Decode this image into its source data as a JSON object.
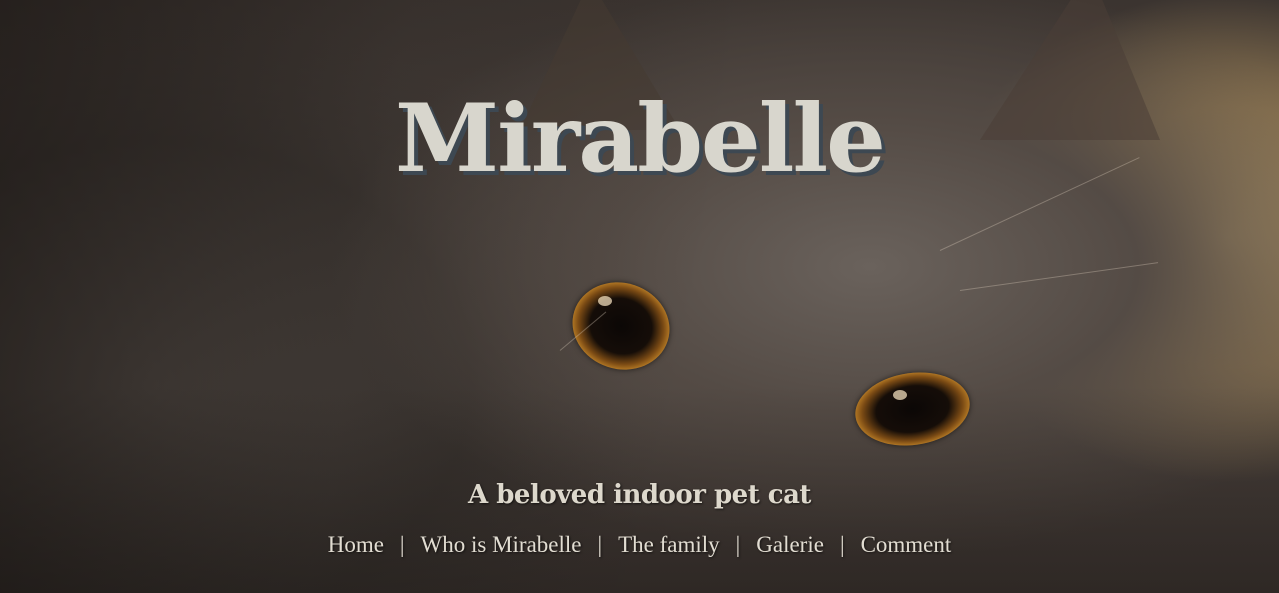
{
  "site": {
    "title": "Mirabelle",
    "tagline": "A beloved indoor pet cat"
  },
  "nav": {
    "separator": "|",
    "items": [
      {
        "label": "Home"
      },
      {
        "label": "Who is Mirabelle"
      },
      {
        "label": "The family"
      },
      {
        "label": "Galerie"
      },
      {
        "label": "Comment"
      }
    ]
  }
}
